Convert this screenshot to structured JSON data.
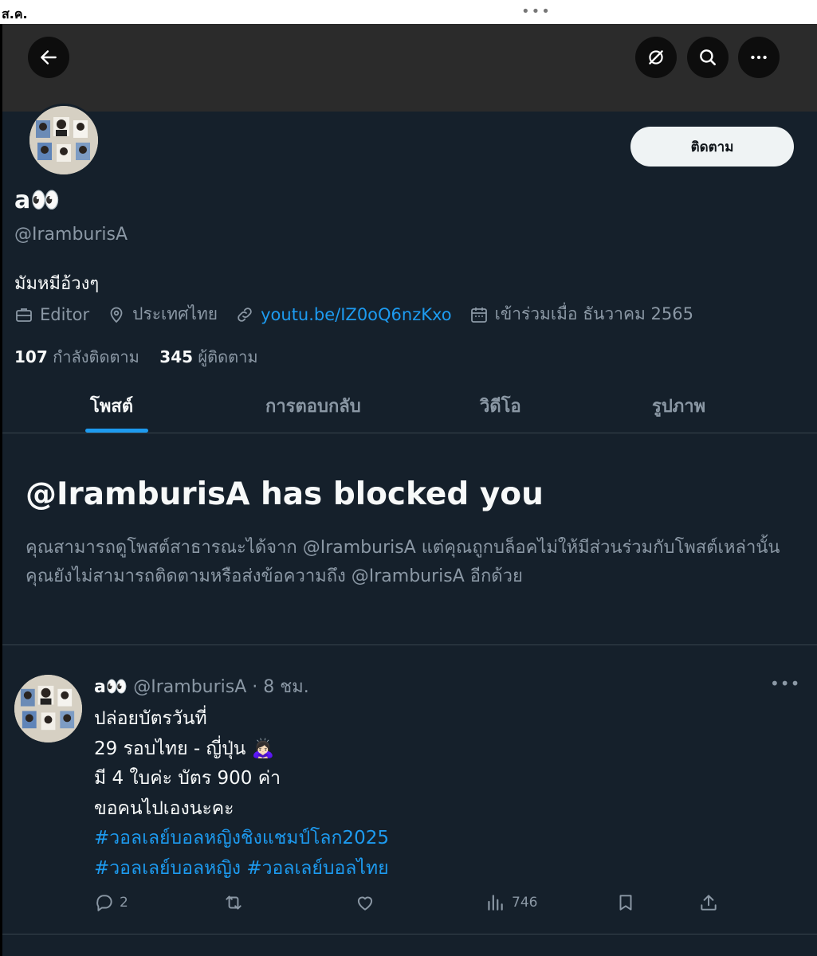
{
  "status_bar": {
    "time": "ส.ค.",
    "dots": "•••"
  },
  "header": {
    "back_icon": "arrow-left-icon",
    "grok_icon": "grok-slash-icon",
    "search_icon": "search-icon",
    "more_icon": "more-dots-icon"
  },
  "profile": {
    "follow_label": "ติดตาม",
    "display_name": "a👀",
    "handle": "@IramburisA",
    "bio": "มัมหมีอ้วงๆ",
    "job": "Editor",
    "location": "ประเทศไทย",
    "link": "youtu.be/IZ0oQ6nzKxo",
    "joined": "เข้าร่วมเมื่อ ธันวาคม 2565",
    "following_count": "107",
    "following_label": "กำลังติดตาม",
    "followers_count": "345",
    "followers_label": "ผู้ติดตาม"
  },
  "tabs": [
    {
      "label": "โพสต์",
      "active": true
    },
    {
      "label": "การตอบกลับ",
      "active": false
    },
    {
      "label": "วิดีโอ",
      "active": false
    },
    {
      "label": "รูปภาพ",
      "active": false
    }
  ],
  "blocked": {
    "title": "@IramburisA has blocked you",
    "description": "คุณสามารถดูโพสต์สาธารณะได้จาก @IramburisA แต่คุณถูกบล็อคไม่ให้มีส่วนร่วมกับโพสต์เหล่านั้น คุณยังไม่สามารถติดตามหรือส่งข้อความถึง @IramburisA อีกด้วย"
  },
  "tweet": {
    "name": "a👀",
    "handle": "@IramburisA",
    "time": "· 8 ชม.",
    "lines": [
      "ปล่อยบัตรวันที่",
      "29 รอบไทย - ญี่ปุ่น 🙇🏻‍♀️",
      "มี 4  ใบค่ะ บัตร 900 ค่า",
      "ขอคนไปเองนะคะ"
    ],
    "hashtags_line1": "#วอลเลย์บอลหญิงชิงแชมป์โลก2025",
    "hashtags_line2a": "#วอลเลย์บอลหญิง",
    "hashtags_line2b": "#วอลเลย์บอลไทย",
    "reply_count": "2",
    "views": "746"
  }
}
